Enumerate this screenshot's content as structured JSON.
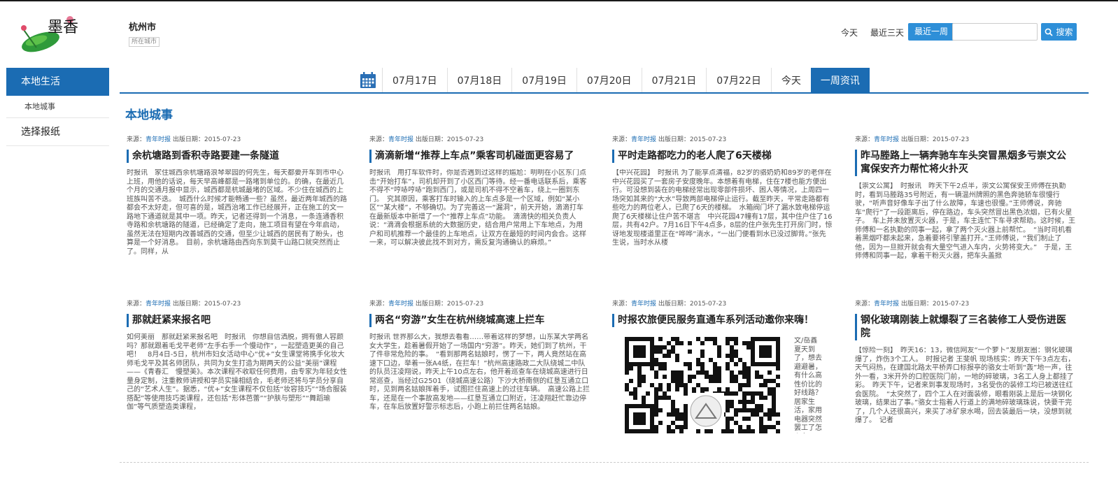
{
  "logo": {
    "text": "墨香"
  },
  "city": {
    "name": "杭州市",
    "sub": "所在城市"
  },
  "header": {
    "today": "今天",
    "last3": "最近三天",
    "lastweek": "最近一周",
    "search_label": "搜索",
    "search_placeholder": ""
  },
  "sidebar": {
    "active": "本地生活",
    "sub": "本地城事",
    "item": "选择报纸"
  },
  "tabs": [
    "07月17日",
    "07月18日",
    "07月19日",
    "07月20日",
    "07月21日",
    "07月22日",
    "今天",
    "一周资讯"
  ],
  "section_title": "本地城事",
  "meta": {
    "source_label": "来源：",
    "source": "青年时报",
    "date_label": " 出版日期：",
    "date": "2015-07-23"
  },
  "articles": [
    {
      "title": "余杭塘路到香积寺路要建一条隧道",
      "body": "时报讯　家住城西余杭塘路浪琴翠园的何先生，每天都要开车到市中心上班，用他的话说，每天早高峰都是一路堵到单位的。的确，在最近几个月的交通月报中显示，城西都是杭城最堵的区域。不少住在城西的上班族叫苦不迭。　城西什么时候才能畅通一些？虽然，最近两年城西的路都会不太好走，但可喜的是，城西治堵工作已经展开，正在施工的文一路地下通道就是其中一项。昨天，记者还得到一个消息，一条连通香积寺路和余杭塘路的隧道，已经确定了走向，施工项目有望在今年启动，虽然无法在短期内改善城西的交通，但至少让城西的居民有了盼头，也算是一个好消息。　目前，余杭塘路由西向东到莫干山路口就突然而止了。同样，从"
    },
    {
      "title": "滴滴新增“推荐上车点”乘客司机碰面更容易了",
      "body": "时报讯　用打车软件时，你是否遇到过这样的尴尬：明明在小区东门点击“开始打车”，司机却开到了小区西门等待。经一番电话联系后，乘客不得不“哼哧哼哧”跑到西门，或是司机不得不空着车，绕上一圈到东门。　究其原因，乘客打车时输入的上车点多是一个区域，例如“某小区”“某大楼”，不够确切。为了完善这一“漏洞”，前天开始，滴滴打车在最新版本中新增了一个“推荐上车点”功能。　滴滴快的相关负责人说：“滴滴会根据系统的大数据历史，结合用户常用上下车地点，为用户和司机推荐一个最佳的上车地点，让双方在最短的时间内会合。这样一来，可以解决彼此找不到对方，需反复沟通确认的麻烦。”"
    },
    {
      "title": "平时走路都吃力的老人爬了6天楼梯",
      "body": "【中兴花园】　时报讯 为了能享点清福，82岁的骆奶奶和89岁的老伴在中兴花园买了一套房子安度晚年。本想着有电梯，住在7楼也能方便出行。可没想到装在的电梯经常出现零部件损坏、困人等情况，上周四一场突如其来的“大水”导致两部电梯停止运行。截至昨天，平常走路都有些吃力的两位老人，已爬了6天的楼梯。　水箱阀门坏了漏水致电梯停运　爬了6天楼梯让住户苦不堪言　中兴花园47幢有17层，其中住户住了16层，共有42户。7月16日下午4点多，8层的住户张先生打开房门时，惊讶地发现楼道里正在“哗哗”淌水，“一出门便看到水已没过脚背。”张先生说，当时水从楼"
    },
    {
      "title": "昨马塍路上一辆奔驰车车头突冒黑烟多亏崇文公寓保安齐力帮忙将火扑灭",
      "body": "【崇文公寓】　时报讯　昨天下午2点半，崇文公寓保安王师傅在执勤时，看到马塍路35号附近，有一辆温州牌照的黑色奔驰轿车很慢行驶，“听声音好像车子出了什么故障，车速也很慢。”王师傅说，奔驰车“爬行”了一段距离后，停在路边，车头突然冒出黑色浓烟，已有火星子。　车上并未放置灭火器，于是，车主连忙下车寻求帮助。这时候，王师傅和一名执勤的同事一起，拿了两个灭火器上前帮忙。　“当时司机看着黑烟吓都未起来，急着要将引擎盖打开。”王师傅说，“我们制止了他，因为一旦掀开就会有大量空气进入车内，火势将变大。”　于是，王师傅和同事一起，拿着干粉灭火器，把车头盖掀"
    },
    {
      "title": "那就赶紧来报名吧",
      "body": "如何美丽　那就赶紧来报名吧　时报讯　你想自信洒脱，拥有傲人容颜吗？那就跟着毛戈平老师“左手右手一个慢动作”，一起塑造更美的自己吧！　8月4日-5日，杭州市妇女活动中心“优+”女生课堂将携手化妆大师毛戈平及其名师团队，共同为女生打造为期两天的公益“美丽”课程——《青春汇　慢塑美》。本次课程不收取任何费用，由专家为年轻女性量身定制，注重教师讲授和学员实操相结合，毛老师还将与学员分享自己的“艺术人生”。据悉，“优+”女生课程不仅包括“妆容技巧”“场合服装搭配”等使用技巧类课程，还包括“形体芭蕾”“护肤与塑形”“舞蹈瑜伽”等气质塑造类课程，"
    },
    {
      "title": "两名“穷游”女生在杭州绕城高速上拦车",
      "body": "时报讯 世界那么大，我想去看看……带着这样的梦想，山东某大学两名女大学生，趁着暑假开始了一场国内“穷游”。昨天，她们到了杭州，干了件非常危险的事。　“看到那两名姑娘时，愣了一下，两人竟然站在高速下口边，举着一张A4纸，在拦车！”杭州高速路政二大队绕城二中队的队员汪凌翔说，昨天上午10点左右，他开着巡查车在绕城高速进行日常巡查，当经过G2501（绕城高速公路）下沙大桥南侧的红垦互通立口时，见到两名姑娘挥着手，试图拦住高速上的过往车辆。　高速公路上拦车，还是在一个事故高发地——红垦互通立口附近，汪凌翔赶忙靠边停车，在车后放置好警示标志后，小跑上前拦住两名姑娘。"
    },
    {
      "title": "时报农旅便民服务直通车系列活动邀你来嗨！",
      "body": "文/岳鑫　夏天到了，想去避避暑，有什么高性价比的好线路？居家生活，家用电器突然罢工了怎么办？"
    },
    {
      "title": "钢化玻璃刚装上就爆裂了三名装修工人受伤进医院",
      "body": "【惊险一刻】　昨天16：13，微信网友“一个萝卜”发朋友圈：钢化玻璃爆了，炸伤3个工人。　时报记者 王斐帆 现场核实：昨天下午3点左右，天气闷热，在建国北路太平桥弄口标报亭的骆女士听到“轰”地一声，往外一看，3米开外的口腔医院门前，一地的碎玻璃，3名工人身上都挂了彩。　昨天下午，记者来到事发现场时，3名受伤的装修工均已被送往红会医院。　“太突然了，四个工人在对面装修，眼看刚装上是后一块钢化玻璃，结果出了事。”骆女士指着人行道上的满地碎玻璃珠说，快要干完了，几个人还很高兴，来买了冰矿泉水喝，回去装最后一块，没想到就爆了。　记者"
    }
  ],
  "colors": {
    "brand": "#1b6cb3",
    "accent": "#2e8fd8"
  }
}
